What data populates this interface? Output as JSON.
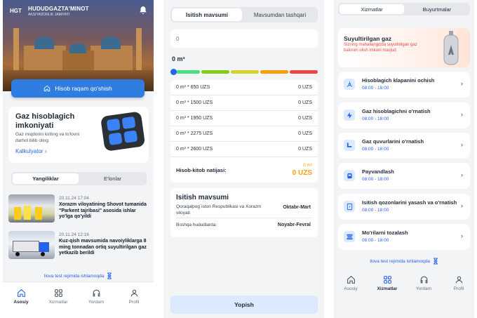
{
  "panel1": {
    "logo": {
      "mark": "HGT",
      "title": "HUDUDGAZTA'MINOT",
      "subtitle": "AKSIYADORLIK JAMIYATI"
    },
    "account_button": "Hisob raqam qo'shish",
    "gas_card": {
      "title": "Gaz hisoblagich imkoniyati",
      "text": "Gaz miqdorini kiriting va to'lovni darhol bilib oling",
      "link": "Kalkulyator"
    },
    "tabs": [
      "Yangiliklar",
      "E'lonlar"
    ],
    "news": [
      {
        "date": "20.11.24 17:04",
        "title": "Xorazm viloyatining Shovot tumanida \"Parkent tajribasi\" asosida ishlar yo'lga qo'yildi"
      },
      {
        "date": "20.11.24 12:16",
        "title": "Kuz-qish mavsumida navoiyliklarga 8 ming tonnadan ortiq suyultirilgan gaz yetkazib berildi"
      }
    ],
    "test_banner": "Ilova test rejimida ishlamoqda",
    "nav": [
      "Asosiy",
      "Xizmatlar",
      "Yordam",
      "Profil"
    ]
  },
  "panel2": {
    "tabs": [
      "Isitish mavsumi",
      "Mavsumdan tashqari"
    ],
    "input_value": "0",
    "volume_label": "0 m³",
    "scale_colors": [
      "#4ade80",
      "#84cc16",
      "#d4d42e",
      "#f59e0b",
      "#ef4444"
    ],
    "rows": [
      {
        "label": "0 m³ * 650 UZS",
        "value": "0  UZS"
      },
      {
        "label": "0 m³ * 1500 UZS",
        "value": "0  UZS"
      },
      {
        "label": "0 m³ * 1950 UZS",
        "value": "0  UZS"
      },
      {
        "label": "0 m³ * 2275 UZS",
        "value": "0  UZS"
      },
      {
        "label": "0 m³ * 2600 UZS",
        "value": "0  UZS"
      }
    ],
    "total": {
      "label": "Hisob-kitob natijasi:",
      "volume": "0 m³",
      "amount": "0 UZS"
    },
    "season": {
      "title": "Isitish mavsumi",
      "regions1": "Qoraqalpog`iston Respublikasi va Xorazm viloyati",
      "period1": "Oktabr-Mart",
      "regions2": "Boshqa hududlarda:",
      "period2": "Noyabr-Fevral"
    },
    "see_button": "Yopish"
  },
  "panel3": {
    "tabs": [
      "Xizmatlar",
      "Buyurtmalar"
    ],
    "liquefied": {
      "title": "Suyultirilgan gaz",
      "text": "Sizning mahallangizda suyultirilgan gaz balonini olish imkoni mavjud"
    },
    "services": [
      {
        "title": "Hisoblagich klapanini ochish",
        "hours": "08:00 - 18:00",
        "icon": "valve-icon"
      },
      {
        "title": "Gaz hisoblagichni o'rnatish",
        "hours": "08:00 - 18:00",
        "icon": "lightning-icon"
      },
      {
        "title": "Gaz quvurlarini o'rnatish",
        "hours": "08:00 - 18:00",
        "icon": "pipe-icon"
      },
      {
        "title": "Payvandlash",
        "hours": "08:00 - 18:00",
        "icon": "welding-icon"
      },
      {
        "title": "Isitish qozonlarini yasash va o'rnatish",
        "hours": "08:00 - 18:00",
        "icon": "boiler-icon"
      },
      {
        "title": "Mo'rilarni tozalash",
        "hours": "08:00 - 18:00",
        "icon": "chimney-icon"
      }
    ],
    "test_banner": "Ilova test rejimida ishlamoqda",
    "nav": [
      "Asosiy",
      "Xizmatlar",
      "Yordam",
      "Profil"
    ]
  }
}
